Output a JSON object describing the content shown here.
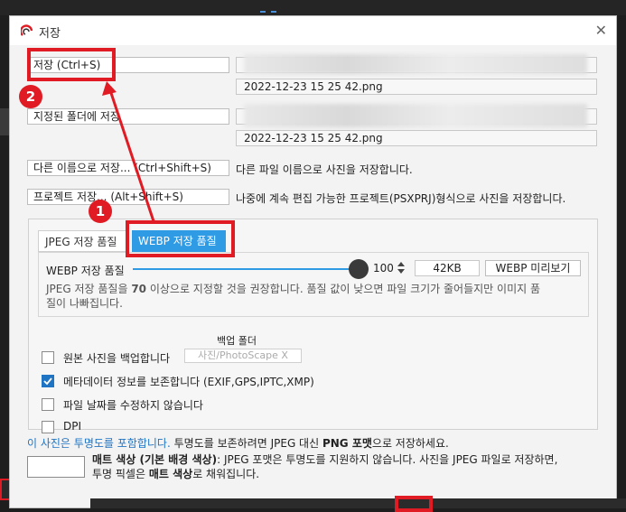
{
  "dialog": {
    "title": "저장"
  },
  "rows": [
    {
      "button": "저장   (Ctrl+S)",
      "path": "2022-12-23 15 25 42.png"
    },
    {
      "button": "지정된 폴더에 저장",
      "path": "2022-12-23 15 25 42.png"
    }
  ],
  "save_as": {
    "button": "다른 이름으로 저장...  (Ctrl+Shift+S)",
    "desc": "다른 파일 이름으로 사진을 저장합니다."
  },
  "project": {
    "button": "프로젝트 저장...  (Alt+Shift+S)",
    "desc": "나중에 계속 편집 가능한 프로젝트(PSXPRJ)형식으로 사진을 저장합니다."
  },
  "tabs": [
    {
      "label": "JPEG 저장 품질"
    },
    {
      "label": "WEBP 저장 품질"
    }
  ],
  "quality": {
    "label": "WEBP 저장 품질",
    "value": "100",
    "level": 1.0,
    "size": "42KB",
    "preview_button": "WEBP 미리보기",
    "hint_pre": "JPEG 저장 품질을 ",
    "hint_num": "70",
    "hint_post": " 이상으로 지정할 것을 권장합니다. 품질 값이 낮으면 파일 크기가 줄어들지만 이미지 품",
    "hint_line2": "질이 나빠집니다."
  },
  "backup_folder_label": "백업 폴더",
  "backup_folder_value": "사진/PhotoScape X",
  "options": [
    {
      "label": "원본 사진을 백업합니다",
      "checked": false
    },
    {
      "label": "메타데이터 정보를 보존합니다 (EXIF,GPS,IPTC,XMP)",
      "checked": true
    },
    {
      "label": "파일 날짜를 수정하지 않습니다",
      "checked": false
    },
    {
      "label": "DPI",
      "checked": false
    }
  ],
  "transparency": {
    "blue_text": "이 사진은 투명도를 포함합니다.",
    "rest_a": " 투명도를 보존하려면 JPEG 대신 ",
    "png": "PNG 포맷",
    "rest_b": "으로 저장하세요."
  },
  "matte": {
    "bold": "매트 색상 (기본 배경 색상)",
    "text1": ": JPEG 포맷은 투명도를 지원하지 않습니다. 사진을 JPEG 파일로 저장하면,",
    "text2a": "투명 픽셀은 ",
    "bold2": "매트 색상",
    "text2b": "로 채워집니다."
  },
  "annotations": [
    {
      "number": "1"
    },
    {
      "number": "2"
    }
  ],
  "colors": {
    "accent": "#2f9be5",
    "annotation": "#e01b24",
    "check": "#1f74c4"
  }
}
